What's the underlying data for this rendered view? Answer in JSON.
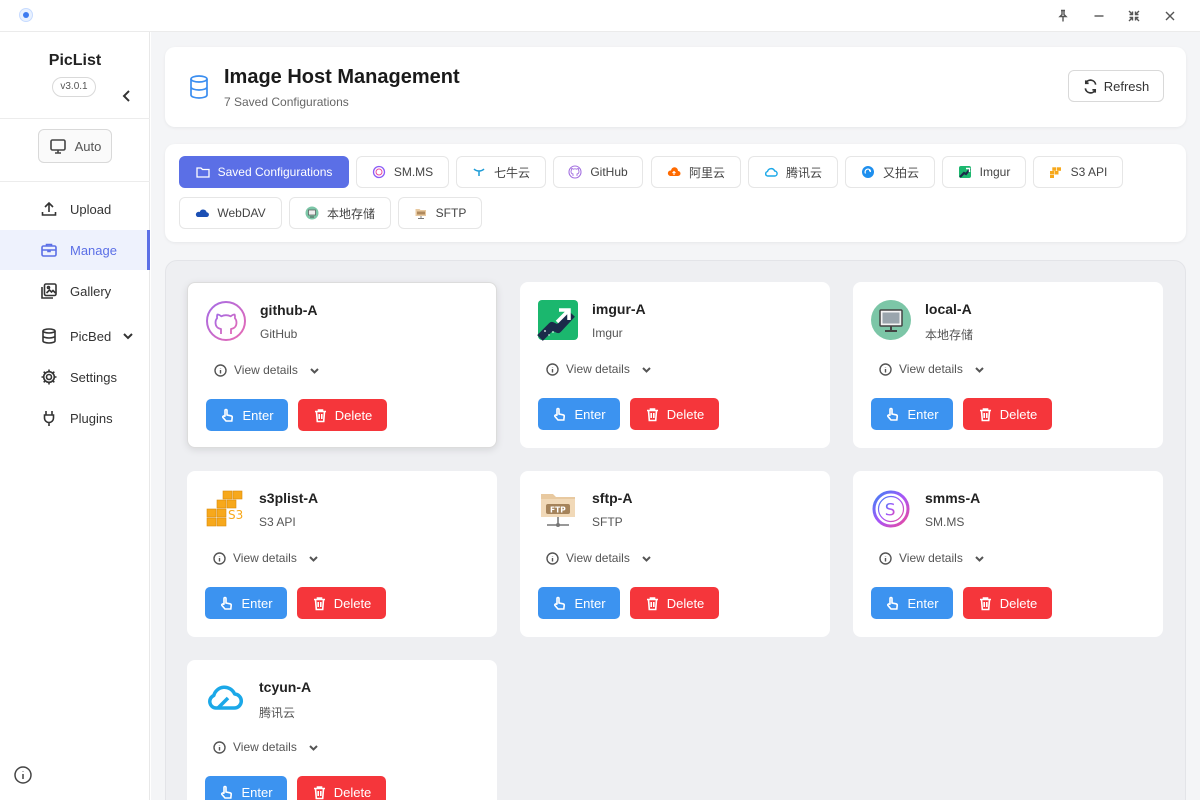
{
  "app": {
    "name": "PicList",
    "version": "v3.0.1"
  },
  "sidebar": {
    "theme_label": "Auto",
    "items": [
      {
        "label": "Upload",
        "icon": "upload-icon"
      },
      {
        "label": "Manage",
        "icon": "briefcase-icon",
        "active": true
      },
      {
        "label": "Gallery",
        "icon": "gallery-icon"
      },
      {
        "label": "PicBed",
        "icon": "database-icon",
        "has_submenu": true
      },
      {
        "label": "Settings",
        "icon": "gear-icon"
      },
      {
        "label": "Plugins",
        "icon": "plug-icon"
      }
    ]
  },
  "header": {
    "title": "Image Host Management",
    "subtitle": "7 Saved Configurations",
    "refresh_label": "Refresh"
  },
  "tabs": [
    {
      "label": "Saved Configurations",
      "icon": "folder-icon",
      "active": true
    },
    {
      "label": "SM.MS",
      "icon": "smms-icon"
    },
    {
      "label": "七牛云",
      "icon": "qiniu-icon"
    },
    {
      "label": "GitHub",
      "icon": "github-icon"
    },
    {
      "label": "阿里云",
      "icon": "aliyun-icon"
    },
    {
      "label": "腾讯云",
      "icon": "tcyun-icon"
    },
    {
      "label": "又拍云",
      "icon": "upyun-icon"
    },
    {
      "label": "Imgur",
      "icon": "imgur-icon"
    },
    {
      "label": "S3 API",
      "icon": "s3-icon"
    },
    {
      "label": "WebDAV",
      "icon": "webdav-icon"
    },
    {
      "label": "本地存储",
      "icon": "local-icon"
    },
    {
      "label": "SFTP",
      "icon": "sftp-icon"
    }
  ],
  "configs": [
    {
      "name": "github-A",
      "type": "GitHub",
      "logo": "github-logo"
    },
    {
      "name": "imgur-A",
      "type": "Imgur",
      "logo": "imgur-logo"
    },
    {
      "name": "local-A",
      "type": "本地存储",
      "logo": "local-logo"
    },
    {
      "name": "s3plist-A",
      "type": "S3 API",
      "logo": "s3-logo"
    },
    {
      "name": "sftp-A",
      "type": "SFTP",
      "logo": "sftp-logo"
    },
    {
      "name": "smms-A",
      "type": "SM.MS",
      "logo": "smms-logo"
    },
    {
      "name": "tcyun-A",
      "type": "腾讯云",
      "logo": "tcyun-logo"
    }
  ],
  "card_actions": {
    "details_label": "View details",
    "enter_label": "Enter",
    "delete_label": "Delete"
  },
  "colors": {
    "accent": "#5b6fe6",
    "enter": "#3c93f0",
    "delete": "#f5363b"
  }
}
